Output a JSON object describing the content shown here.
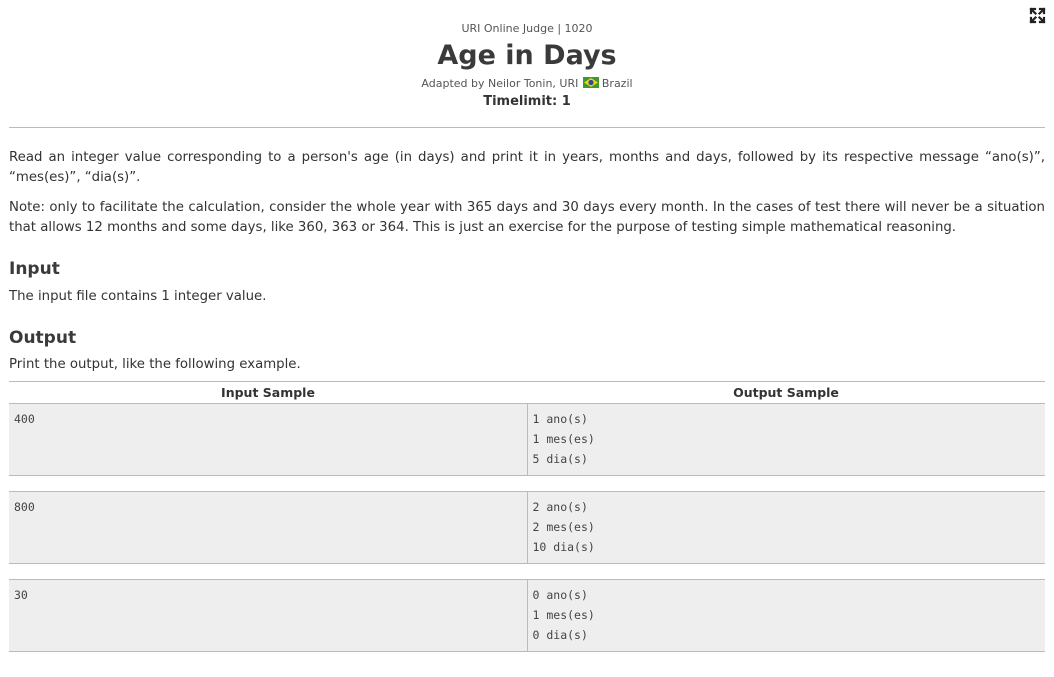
{
  "header": {
    "judge": "URI Online Judge | 1020",
    "title": "Age in Days",
    "author_prefix": "Adapted by Neilor Tonin, URI",
    "country": "Brazil",
    "timelimit": "Timelimit: 1",
    "colors": {
      "flag_green": "#3e9a2a",
      "flag_yellow": "#f2d21b",
      "flag_blue": "#2a4f9c"
    }
  },
  "description": {
    "p1": "Read an integer value corresponding to a person's age (in days) and print it in years, months and days, followed by its respective message “ano(s)”, “mes(es)”, “dia(s)”.",
    "p2": "Note: only to facilitate the calculation, consider the whole year with 365 days and 30 days every month. In the cases of test there will never be a situation that allows 12 months and some days, like 360, 363 or 364. This is just an exercise for the purpose of testing simple mathematical reasoning."
  },
  "input": {
    "heading": "Input",
    "text": "The input file contains 1 integer value."
  },
  "output": {
    "heading": "Output",
    "text": "Print the output, like the following example."
  },
  "samples": {
    "input_header": "Input Sample",
    "output_header": "Output Sample",
    "rows": [
      {
        "input": "400",
        "output": [
          "1 ano(s)",
          "1 mes(es)",
          "5 dia(s)"
        ]
      },
      {
        "input": "800",
        "output": [
          "2 ano(s)",
          "2 mes(es)",
          "10 dia(s)"
        ]
      },
      {
        "input": "30",
        "output": [
          "0 ano(s)",
          "1 mes(es)",
          "0 dia(s)"
        ]
      }
    ]
  },
  "icons": {
    "expand": "expand-arrows-icon",
    "flag": "brazil-flag-icon"
  }
}
